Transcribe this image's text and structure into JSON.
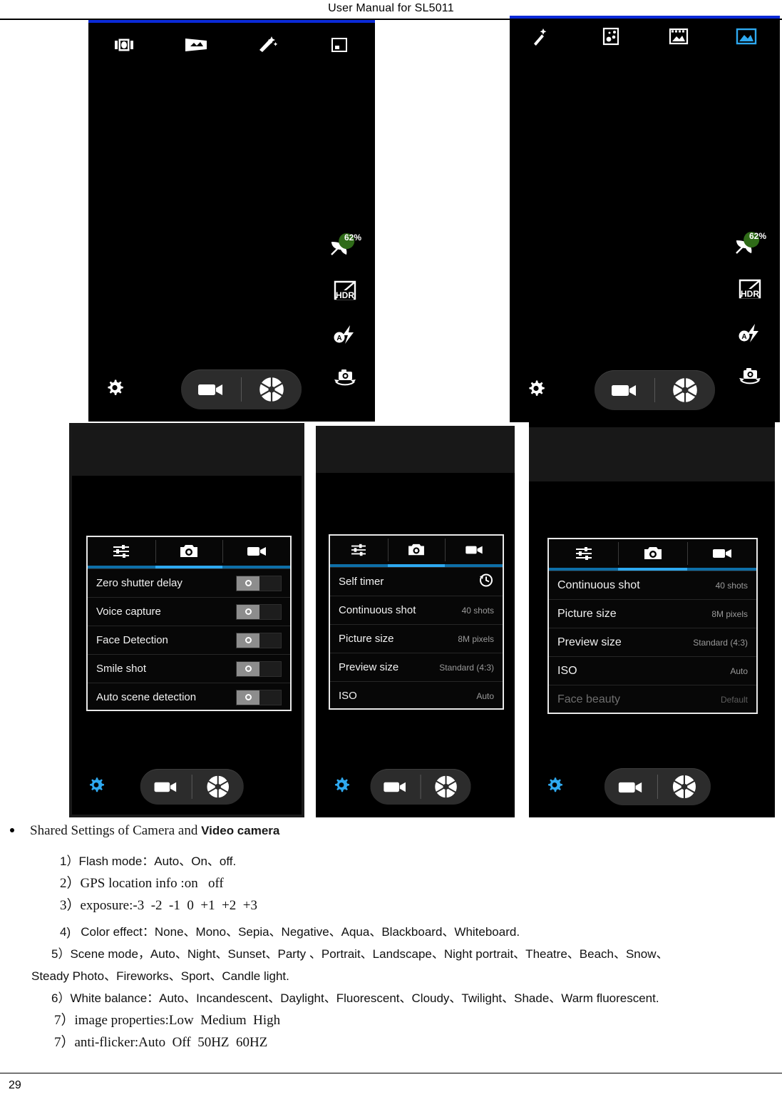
{
  "document": {
    "header_title": "User Manual for SL5011",
    "page_number": "29"
  },
  "viewfinders": [
    {
      "name": "camera-viewfinder-left",
      "top_icons": [
        {
          "icon": "multi-angle-view-icon",
          "active": false
        },
        {
          "icon": "panorama-icon",
          "active": false
        },
        {
          "icon": "magic-wand-icon",
          "active": false
        },
        {
          "icon": "photo-frame-icon",
          "active": false
        }
      ],
      "right_controls": [
        {
          "icon": "battery-leaf-icon",
          "label": "62%"
        },
        {
          "icon": "hdr-icon",
          "label": "HDR"
        },
        {
          "icon": "flash-auto-icon",
          "label": "A"
        },
        {
          "icon": "switch-camera-icon",
          "label": ""
        }
      ],
      "bottom": {
        "settings_icon": "gear-icon",
        "settings_active": false,
        "video_icon": "video-camera-icon",
        "shutter_icon": "aperture-shutter-icon"
      }
    },
    {
      "name": "camera-viewfinder-right",
      "top_icons": [
        {
          "icon": "magic-wand-icon",
          "active": false
        },
        {
          "icon": "multi-angle-view-icon",
          "active": false
        },
        {
          "icon": "film-strip-icon",
          "active": false
        },
        {
          "icon": "gallery-photo-icon",
          "active": true
        }
      ],
      "right_controls": [
        {
          "icon": "battery-leaf-icon",
          "label": "62%"
        },
        {
          "icon": "hdr-icon",
          "label": "HDR"
        },
        {
          "icon": "flash-auto-icon",
          "label": "A"
        },
        {
          "icon": "switch-camera-icon",
          "label": ""
        }
      ],
      "bottom": {
        "settings_icon": "gear-icon",
        "settings_active": false,
        "video_icon": "video-camera-icon",
        "shutter_icon": "aperture-shutter-icon"
      }
    }
  ],
  "settings_panels": [
    {
      "name": "settings-panel-toggles",
      "tabs": [
        {
          "icon": "sliders-icon",
          "label": "General",
          "active": false
        },
        {
          "icon": "camera-icon",
          "label": "Camera",
          "active": true
        },
        {
          "icon": "video-camera-icon",
          "label": "Video",
          "active": false
        }
      ],
      "rows": [
        {
          "label": "Zero shutter delay",
          "control": "toggle",
          "value": "off"
        },
        {
          "label": "Voice capture",
          "control": "toggle",
          "value": "off"
        },
        {
          "label": "Face Detection",
          "control": "toggle",
          "value": "off"
        },
        {
          "label": "Smile shot",
          "control": "toggle",
          "value": "off"
        },
        {
          "label": "Auto scene detection",
          "control": "toggle",
          "value": "off"
        }
      ],
      "bottom": {
        "settings_icon": "gear-icon",
        "settings_active": true,
        "video_icon": "video-camera-icon",
        "shutter_icon": "aperture-shutter-icon"
      }
    },
    {
      "name": "settings-panel-capture",
      "tabs": [
        {
          "icon": "sliders-icon",
          "label": "General",
          "active": false
        },
        {
          "icon": "camera-icon",
          "label": "Camera",
          "active": true
        },
        {
          "icon": "video-camera-icon",
          "label": "Video",
          "active": false
        }
      ],
      "rows": [
        {
          "label": "Self timer",
          "control": "icon",
          "value": "",
          "icon": "clock-icon"
        },
        {
          "label": "Continuous shot",
          "control": "value",
          "value": "40 shots"
        },
        {
          "label": "Picture size",
          "control": "value",
          "value": "8M pixels"
        },
        {
          "label": "Preview size",
          "control": "value",
          "value": "Standard (4:3)"
        },
        {
          "label": "ISO",
          "control": "value",
          "value": "Auto"
        }
      ],
      "bottom": {
        "settings_icon": "gear-icon",
        "settings_active": true,
        "video_icon": "video-camera-icon",
        "shutter_icon": "aperture-shutter-icon"
      }
    },
    {
      "name": "settings-panel-capture-scrolled",
      "tabs": [
        {
          "icon": "sliders-icon",
          "label": "General",
          "active": false
        },
        {
          "icon": "camera-icon",
          "label": "Camera",
          "active": true
        },
        {
          "icon": "video-camera-icon",
          "label": "Video",
          "active": false
        }
      ],
      "rows": [
        {
          "label": "Continuous shot",
          "control": "value",
          "value": "40 shots"
        },
        {
          "label": "Picture size",
          "control": "value",
          "value": "8M pixels"
        },
        {
          "label": "Preview size",
          "control": "value",
          "value": "Standard (4:3)"
        },
        {
          "label": "ISO",
          "control": "value",
          "value": "Auto"
        },
        {
          "label": "Face beauty",
          "control": "value",
          "value": "Default",
          "dim": true
        }
      ],
      "bottom": {
        "settings_icon": "gear-icon",
        "settings_active": true,
        "video_icon": "video-camera-icon",
        "shutter_icon": "aperture-shutter-icon"
      }
    }
  ],
  "body_text": {
    "heading_plain": "Shared Settings of Camera and ",
    "heading_bold": "Video camera",
    "items": [
      "1）Flash mode：Auto、On、off.",
      "2）GPS location info :on   off",
      "3）exposure:-3  -2  -1  0  +1  +2  +3",
      "4)   Color effect：None、Mono、Sepia、Negative、Aqua、Blackboard、Whiteboard.",
      "5）Scene mode，Auto、Night、Sunset、Party 、Portrait、Landscape、Night portrait、Theatre、Beach、Snow、",
      "Steady Photo、Fireworks、Sport、Candle light.",
      "6）White balance：Auto、Incandescent、Daylight、Fluorescent、Cloudy、Twilight、Shade、Warm fluorescent.",
      "7）image properties:Low  Medium  High",
      "7）anti-flicker:Auto  Off  50HZ  60HZ"
    ]
  },
  "colors": {
    "accent_blue": "#2ea9f0",
    "status_blue": "#0a2ad8",
    "gear_active": "#2ea9f0",
    "battery_green": "#2f6b18"
  }
}
